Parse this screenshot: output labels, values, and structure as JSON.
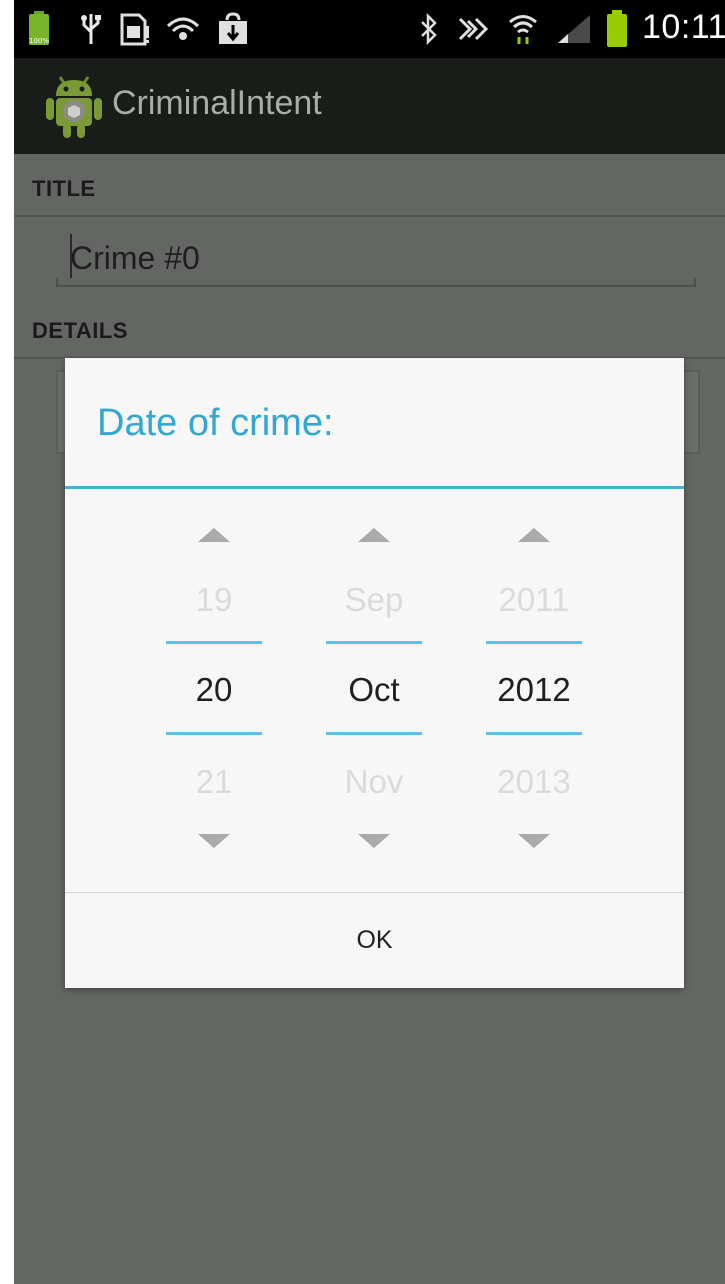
{
  "status_bar": {
    "time": "10:11",
    "battery_percent_badge": "100%",
    "icons": [
      "battery-full-icon",
      "usb-icon",
      "sd-card-icon",
      "wifi-sync-icon",
      "download-icon",
      "bluetooth-icon",
      "nfc-icon",
      "wifi-icon",
      "signal-icon",
      "battery-icon"
    ]
  },
  "action_bar": {
    "app_title": "CriminalIntent",
    "app_icon": "android-robot-icon"
  },
  "form": {
    "title_header": "TITLE",
    "title_value": "Crime #0",
    "details_header": "DETAILS"
  },
  "dialog": {
    "title": "Date of crime:",
    "day": {
      "prev": "19",
      "current": "20",
      "next": "21"
    },
    "month": {
      "prev": "Sep",
      "current": "Oct",
      "next": "Nov"
    },
    "year": {
      "prev": "2011",
      "current": "2012",
      "next": "2013"
    },
    "ok_label": "OK"
  },
  "colors": {
    "accent": "#33b5e5",
    "status_bar_bg": "#000000",
    "action_bar_bg": "#1a1c1a",
    "dim_overlay": "#646664",
    "dialog_bg": "#f7f7f7",
    "battery_green": "#99cc00"
  }
}
